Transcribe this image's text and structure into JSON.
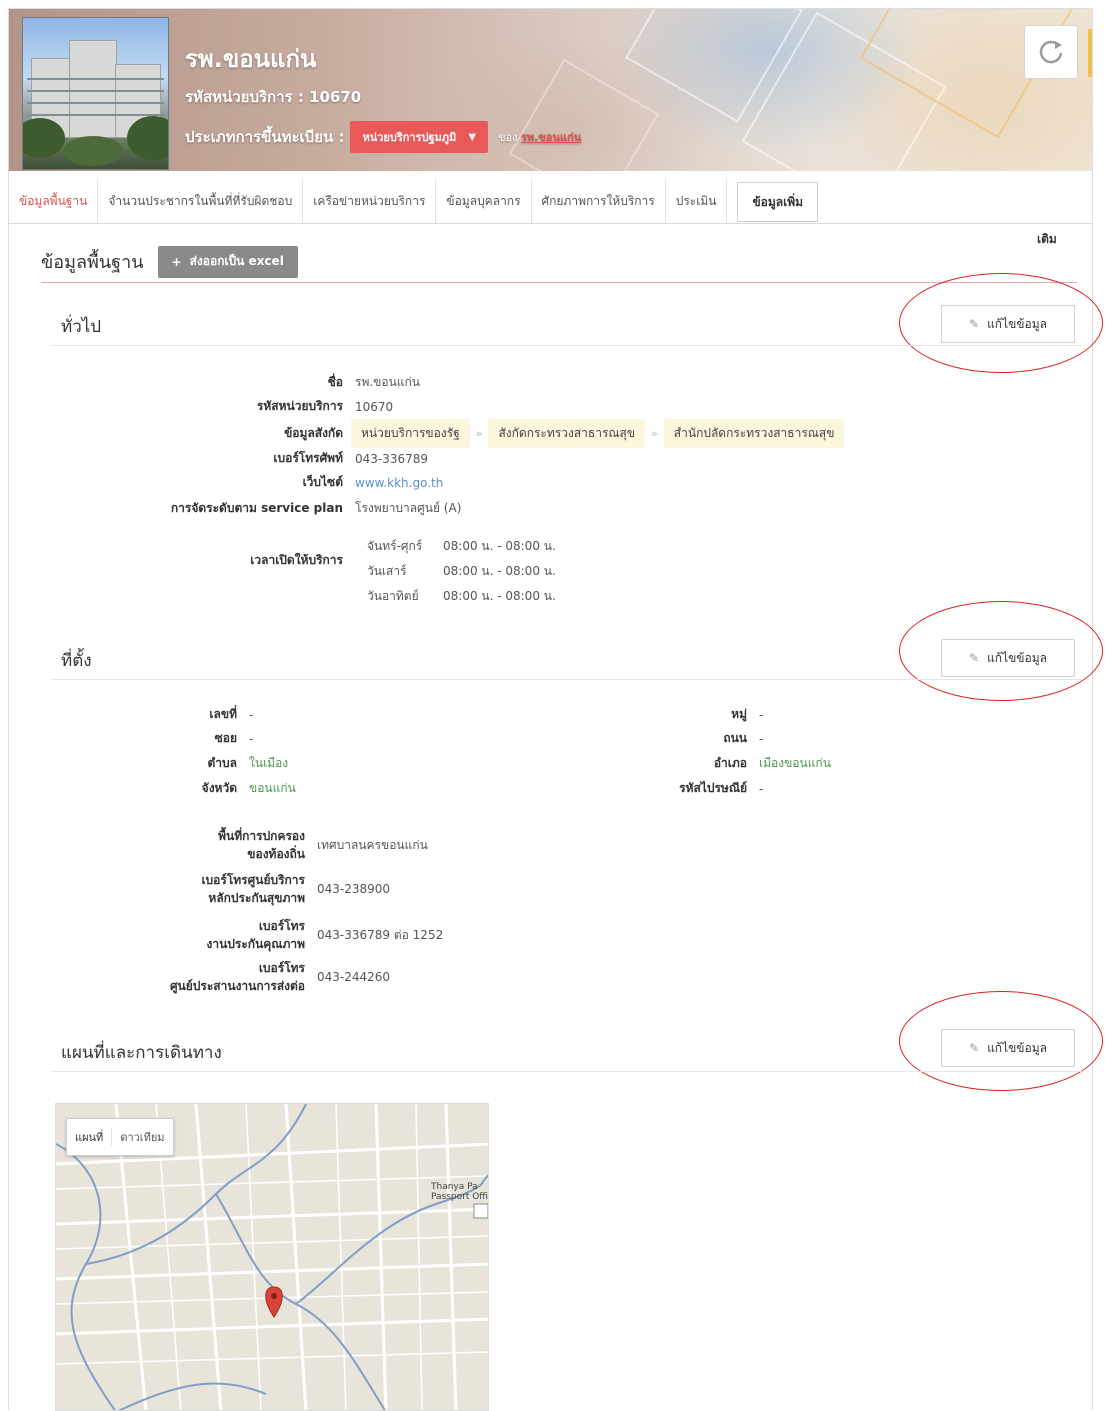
{
  "header": {
    "hospital_name": "รพ.ขอนแก่น",
    "unit_code": "รหัสหน่วยบริการ : 10670",
    "registration_label": "ประเภทการขึ้นทะเบียน :",
    "registration_value": "หน่วยบริการปฐมภูมิ",
    "of_label": "ของ",
    "of_link": "รพ.ขอนแก่น",
    "refresh_icon": "refresh-icon"
  },
  "tabs": [
    {
      "label": "ข้อมูลพื้นฐาน",
      "active": true
    },
    {
      "label": "จำนวนประชากรในพื้นที่ที่รับผิดชอบ"
    },
    {
      "label": "เครือข่ายหน่วยบริการ"
    },
    {
      "label": "ข้อมูลบุคลากร"
    },
    {
      "label": "ศักยภาพการให้บริการ"
    },
    {
      "label": "ประเมิน"
    }
  ],
  "tab_more": {
    "line1": "ข้อมูลเพิ่ม",
    "line2": "เติม"
  },
  "page": {
    "title": "ข้อมูลพื้นฐาน",
    "export_label": "ส่งออกเป็น excel"
  },
  "general": {
    "title": "ทั่วไป",
    "edit_label": "แก้ไขข้อมูล",
    "rows": {
      "name_label": "ชื่อ",
      "name_value": "รพ.ขอนแก่น",
      "code_label": "รหัสหน่วยบริการ",
      "code_value": "10670",
      "affil_label": "ข้อมูลสังกัด",
      "affil_chips": [
        "หน่วยบริการของรัฐ",
        "สังกัดกระทรวงสาธารณสุข",
        "สำนักปลัดกระทรวงสาธารณสุข"
      ],
      "phone_label": "เบอร์โทรศัพท์",
      "phone_value": "043-336789",
      "web_label": "เว็บไซต์",
      "web_value": "www.kkh.go.th",
      "plan_label": "การจัดระดับตาม service plan",
      "plan_value": "โรงพยาบาลศูนย์ (A)",
      "hours_label": "เวลาเปิดให้บริการ",
      "hours": [
        {
          "day": "จันทร์-ศุกร์",
          "time": "08:00 น. - 08:00 น."
        },
        {
          "day": "วันเสาร์",
          "time": "08:00 น. - 08:00 น."
        },
        {
          "day": "วันอาทิตย์",
          "time": "08:00 น. - 08:00 น."
        }
      ]
    }
  },
  "location": {
    "title": "ที่ตั้ง",
    "edit_label": "แก้ไขข้อมูล",
    "left": [
      {
        "label": "เลขที่",
        "value": "-"
      },
      {
        "label": "ซอย",
        "value": "-"
      },
      {
        "label": "ตำบล",
        "value": "ในเมือง"
      },
      {
        "label": "จังหวัด",
        "value": "ขอนแก่น"
      }
    ],
    "right": [
      {
        "label": "หมู่",
        "value": "-"
      },
      {
        "label": "ถนน",
        "value": "-"
      },
      {
        "label": "อำเภอ",
        "value": "เมืองขอนแก่น"
      },
      {
        "label": "รหัสไปรษณีย์",
        "value": "-"
      }
    ],
    "admin_label_1": "พื้นที่การปกครอง",
    "admin_label_2": "ของท้องถิ่น",
    "admin_value": "เทศบาลนครขอนแก่น",
    "insure_label_1": "เบอร์โทรศูนย์บริการ",
    "insure_label_2": "หลักประกันสุขภาพ",
    "insure_value": "043-238900",
    "quality_label_1": "เบอร์โทร",
    "quality_label_2": "งานประกันคุณภาพ",
    "quality_value": "043-336789 ต่อ 1252",
    "refer_label_1": "เบอร์โทร",
    "refer_label_2": "ศูนย์ประสานงานการส่งต่อ",
    "refer_value": "043-244260"
  },
  "map_section": {
    "title": "แผนที่และการเดินทาง",
    "edit_label": "แก้ไขข้อมูล",
    "map_button": "แผนที่",
    "satellite_button": "ดาวเทียม",
    "place_label_1": "Thanya Pa",
    "place_label_2": "Passport Offi"
  },
  "colors": {
    "accent_red": "#d9534f",
    "annotation_red": "#e02020",
    "chip_bg": "#fbf6dc",
    "export_gray": "#8a8a8a"
  }
}
